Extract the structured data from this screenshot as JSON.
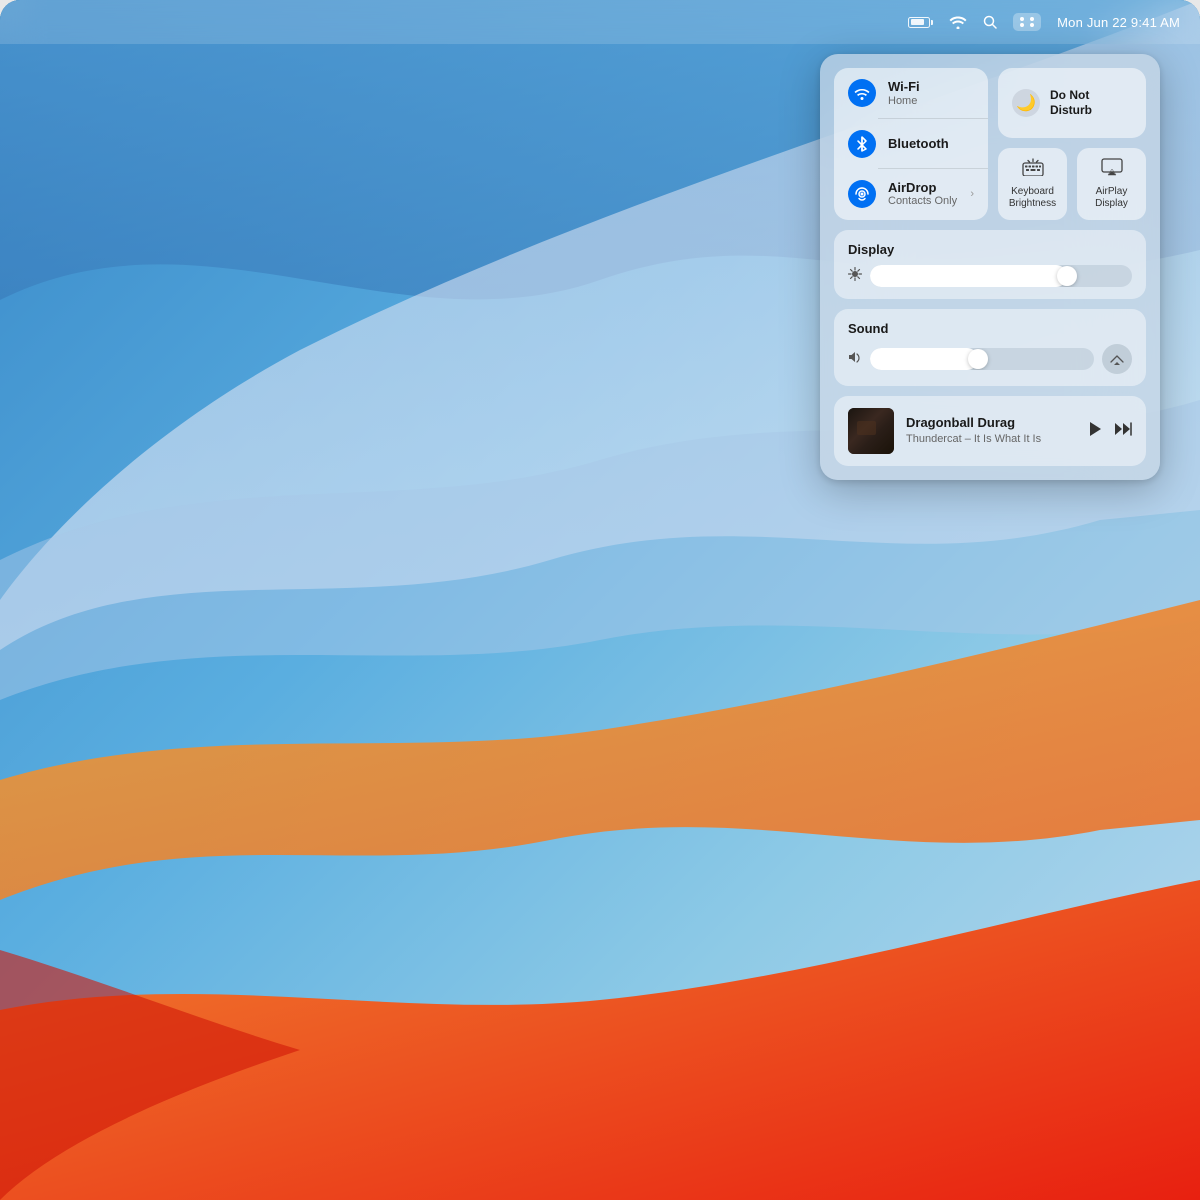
{
  "menubar": {
    "datetime": "Mon Jun 22  9:41 AM",
    "icons": [
      "battery",
      "wifi",
      "search",
      "control-center"
    ]
  },
  "control_center": {
    "connectivity": {
      "wifi": {
        "name": "Wi-Fi",
        "sub": "Home",
        "icon": "wifi"
      },
      "bluetooth": {
        "name": "Bluetooth",
        "sub": "",
        "icon": "bluetooth"
      },
      "airdrop": {
        "name": "AirDrop",
        "sub": "Contacts Only",
        "icon": "airdrop",
        "has_chevron": true
      }
    },
    "do_not_disturb": {
      "label": "Do Not\nDisturb",
      "icon": "moon"
    },
    "keyboard_brightness": {
      "label": "Keyboard\nBrightness",
      "icon": "keyboard-brightness"
    },
    "airplay_display": {
      "label": "AirPlay\nDisplay",
      "icon": "airplay"
    },
    "display": {
      "title": "Display",
      "brightness": 75
    },
    "sound": {
      "title": "Sound",
      "volume": 48
    },
    "now_playing": {
      "title": "Dragonball Durag",
      "artist": "Thundercat – It Is What It Is"
    }
  }
}
